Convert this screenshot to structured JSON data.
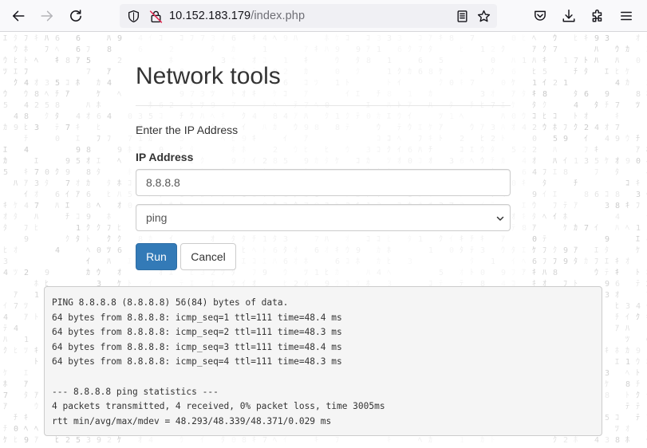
{
  "browser": {
    "url_host": "10.152.183.179",
    "url_path": "/index.php"
  },
  "page": {
    "title": "Network tools",
    "subtitle": "Enter the IP Address",
    "ip_label": "IP Address",
    "ip_value": "8.8.8.8",
    "tool_selected": "ping",
    "run_label": "Run",
    "cancel_label": "Cancel",
    "output_lines": [
      "PING 8.8.8.8 (8.8.8.8) 56(84) bytes of data.",
      "64 bytes from 8.8.8.8: icmp_seq=1 ttl=111 time=48.4 ms",
      "64 bytes from 8.8.8.8: icmp_seq=2 ttl=111 time=48.3 ms",
      "64 bytes from 8.8.8.8: icmp_seq=3 ttl=111 time=48.4 ms",
      "64 bytes from 8.8.8.8: icmp_seq=4 ttl=111 time=48.3 ms",
      "",
      "--- 8.8.8.8 ping statistics ---",
      "4 packets transmitted, 4 received, 0% packet loss, time 3005ms",
      "rtt min/avg/max/mdev = 48.293/48.339/48.371/0.029 ms"
    ]
  },
  "colors": {
    "primary_button": "#337ab7",
    "output_background": "#f5f5f5",
    "browser_toolbar": "#f9f9fb"
  },
  "icons": {
    "toolbar_left": [
      "back-arrow-icon",
      "forward-arrow-icon",
      "reload-icon"
    ],
    "urlbar_left": [
      "shield-icon",
      "insecure-lock-icon"
    ],
    "urlbar_right": [
      "reader-mode-icon",
      "bookmark-star-icon"
    ],
    "toolbar_right": [
      "pocket-icon",
      "downloads-icon",
      "extensions-icon",
      "menu-icon"
    ]
  }
}
